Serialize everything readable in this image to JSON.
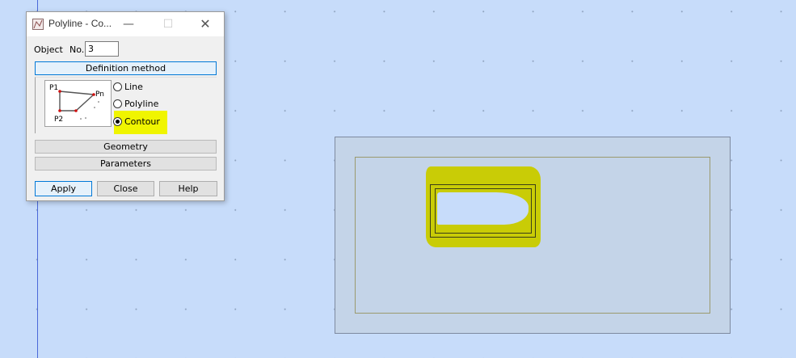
{
  "dialog": {
    "title": "Polyline - Co...",
    "object_label": "Object",
    "no_label": "No.",
    "no_value": "3",
    "sections": {
      "definition_method": "Definition method",
      "geometry": "Geometry",
      "parameters": "Parameters"
    },
    "preview_labels": {
      "p1": "P1",
      "pn": "Pn",
      "p2": "P2"
    },
    "options": [
      {
        "label": "Line",
        "selected": false
      },
      {
        "label": "Polyline",
        "selected": false
      },
      {
        "label": "Contour",
        "selected": true
      }
    ],
    "buttons": {
      "apply": "Apply",
      "close": "Close",
      "help": "Help"
    },
    "titlebar_glyphs": {
      "minimize": "—",
      "maximize": "☐",
      "close": "✕"
    }
  },
  "colors": {
    "canvas": "#c7dcfa",
    "highlight": "#f0f500",
    "annotation": "#c9cc06",
    "focus": "#0078d7"
  }
}
